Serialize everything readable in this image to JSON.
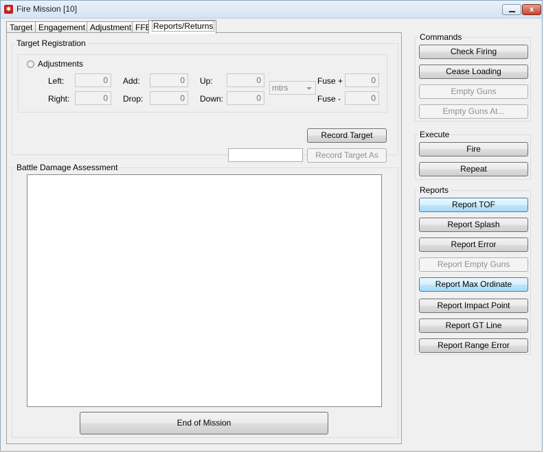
{
  "window": {
    "title": "Fire Mission [10]",
    "close_glyph": "x"
  },
  "tabs": [
    {
      "label": "Target"
    },
    {
      "label": "Engagement"
    },
    {
      "label": "Adjustment"
    },
    {
      "label": "FFE"
    },
    {
      "label": "Reports/Returns",
      "active": true
    }
  ],
  "target_registration": {
    "title": "Target Registration",
    "adjustments": {
      "label": "Adjustments",
      "left": {
        "label": "Left:",
        "value": "0"
      },
      "right": {
        "label": "Right:",
        "value": "0"
      },
      "add": {
        "label": "Add:",
        "value": "0"
      },
      "drop": {
        "label": "Drop:",
        "value": "0"
      },
      "up": {
        "label": "Up:",
        "value": "0"
      },
      "down": {
        "label": "Down:",
        "value": "0"
      },
      "units": {
        "selected": "mtrs"
      },
      "fuse_plus": {
        "label": "Fuse +",
        "value": "0"
      },
      "fuse_minus": {
        "label": "Fuse -",
        "value": "0"
      }
    },
    "record_target": "Record Target",
    "record_target_as": "Record Target As",
    "record_name_value": ""
  },
  "bda": {
    "title": "Battle Damage Assessment",
    "text": ""
  },
  "end_of_mission": "End of Mission",
  "commands": {
    "title": "Commands",
    "check_firing": "Check Firing",
    "cease_loading": "Cease Loading",
    "empty_guns": "Empty Guns",
    "empty_guns_at": "Empty Guns At..."
  },
  "execute": {
    "title": "Execute",
    "fire": "Fire",
    "repeat": "Repeat"
  },
  "reports": {
    "title": "Reports",
    "tof": "Report TOF",
    "splash": "Report Splash",
    "error": "Report Error",
    "empty_guns": "Report Empty Guns",
    "max_ordinate": "Report Max Ordinate",
    "impact_point": "Report Impact Point",
    "gt_line": "Report GT Line",
    "range_error": "Report Range Error"
  },
  "colors": {
    "accent": "#3c7fb1",
    "close": "#c8452b",
    "panel": "#f0f0f0"
  }
}
